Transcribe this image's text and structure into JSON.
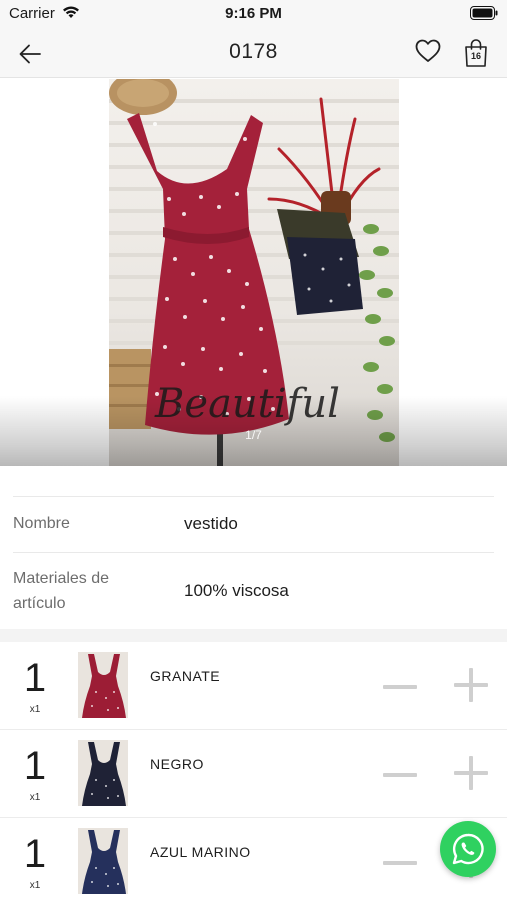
{
  "status_bar": {
    "carrier": "Carrier",
    "time": "9:16 PM"
  },
  "nav": {
    "title": "0178",
    "cart_count": "16"
  },
  "gallery": {
    "page_indicator": "1/7",
    "watermark": "Beautiful"
  },
  "details": {
    "name_label": "Nombre",
    "name_value": "vestido",
    "materials_label_line1": "Materiales de",
    "materials_label_line2": "artículo",
    "materials_value": "100% viscosa"
  },
  "variants": [
    {
      "qty": "1",
      "mult": "x1",
      "name": "GRANATE",
      "color": "#9c1d35"
    },
    {
      "qty": "1",
      "mult": "x1",
      "name": "NEGRO",
      "color": "#1f2236"
    },
    {
      "qty": "1",
      "mult": "x1",
      "name": "AZUL MARINO",
      "color": "#25305c"
    }
  ],
  "icons": {
    "back": "arrow-left-icon",
    "favorite": "heart-icon",
    "cart": "shopping-bag-icon",
    "minus": "minus-icon",
    "plus": "plus-icon",
    "whatsapp": "whatsapp-icon"
  },
  "colors": {
    "accent_whatsapp": "#2fd160",
    "control_gray": "#cfcfcf"
  }
}
